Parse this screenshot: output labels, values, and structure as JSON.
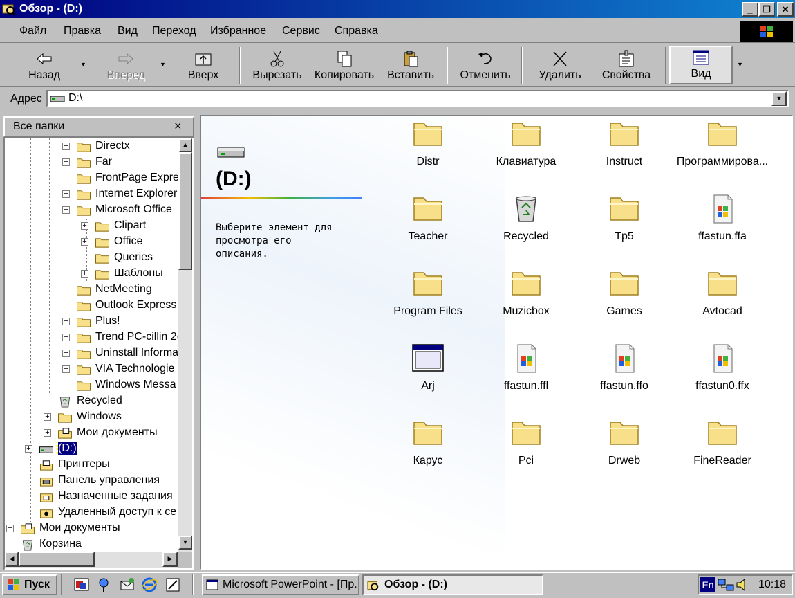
{
  "window": {
    "title": "Обзор -   (D:)"
  },
  "menu": [
    "Файл",
    "Правка",
    "Вид",
    "Переход",
    "Избранное",
    "Сервис",
    "Справка"
  ],
  "toolbar": {
    "back": "Назад",
    "forward": "Вперед",
    "up": "Вверх",
    "cut": "Вырезать",
    "copy": "Копировать",
    "paste": "Вставить",
    "undo": "Отменить",
    "delete": "Удалить",
    "properties": "Свойства",
    "view": "Вид"
  },
  "address": {
    "label": "Адрес",
    "value": "D:\\"
  },
  "folders": {
    "title": "Все папки",
    "close": "×",
    "tree": [
      "Directx",
      "Far",
      "FrontPage Expre",
      "Internet Explorer",
      "Microsoft Office",
      "Clipart",
      "Office",
      "Queries",
      "Шаблоны",
      "NetMeeting",
      "Outlook Express",
      "Plus!",
      "Trend PC-cillin 2(",
      "Uninstall Informa",
      "VIA Technologie",
      "Windows Messa",
      "Recycled",
      "Windows",
      "Мои документы",
      "(D:)",
      "Принтеры",
      "Панель управления",
      "Назначенные задания",
      "Удаленный доступ к се",
      "Мои документы",
      "Корзина"
    ]
  },
  "webview": {
    "drive": "(D:)",
    "description": "Выберите элемент для просмотра его описания."
  },
  "items": [
    "Distr",
    "Клавиатура",
    "Instruct",
    "Программирова...",
    "Teacher",
    "Recycled",
    "Tp5",
    "ffastun.ffa",
    "Program Files",
    "Muzicbox",
    "Games",
    "Avtocad",
    "Arj",
    "ffastun.ffl",
    "ffastun.ffo",
    "ffastun0.ffx",
    "Карус",
    "Pci",
    "Drweb",
    "FineReader"
  ],
  "taskbar": {
    "start": "Пуск",
    "task1": "Microsoft PowerPoint - [Пр...",
    "task2": "Обзор -   (D:)",
    "lang": "En",
    "clock": "10:18"
  },
  "colors": {
    "titlebar_start": "#000080",
    "titlebar_end": "#1084d0",
    "face": "#c0c0c0",
    "folder": "#f8e08a"
  }
}
